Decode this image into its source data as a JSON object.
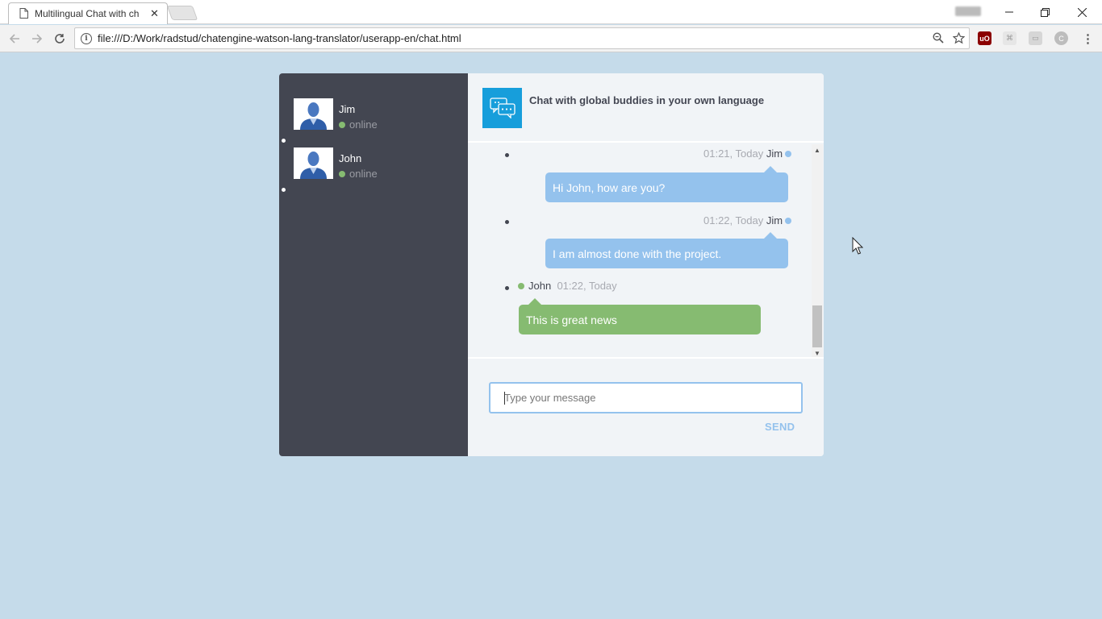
{
  "browser": {
    "tab_title": "Multilingual Chat with ch",
    "url": "file:///D:/Work/radstud/chatengine-watson-lang-translator/userapp-en/chat.html"
  },
  "contacts": [
    {
      "name": "Jim",
      "status": "online"
    },
    {
      "name": "John",
      "status": "online"
    }
  ],
  "header": {
    "title": "Chat with global buddies in your own language"
  },
  "messages": [
    {
      "time": "01:21, Today",
      "sender": "Jim",
      "text": "Hi John, how are you?",
      "mine": true
    },
    {
      "time": "01:22, Today",
      "sender": "Jim",
      "text": "I am almost done with the project.",
      "mine": true
    },
    {
      "time": "01:22, Today",
      "sender": "John",
      "text": "This is great news",
      "mine": false
    }
  ],
  "composer": {
    "placeholder": "Type your message",
    "send_label": "SEND"
  },
  "colors": {
    "background": "#c5dbea",
    "sidebar": "#434651",
    "online": "#86bb71",
    "my_bubble": "#94c2ed",
    "other_bubble": "#86bb71",
    "logo": "#179edb"
  }
}
